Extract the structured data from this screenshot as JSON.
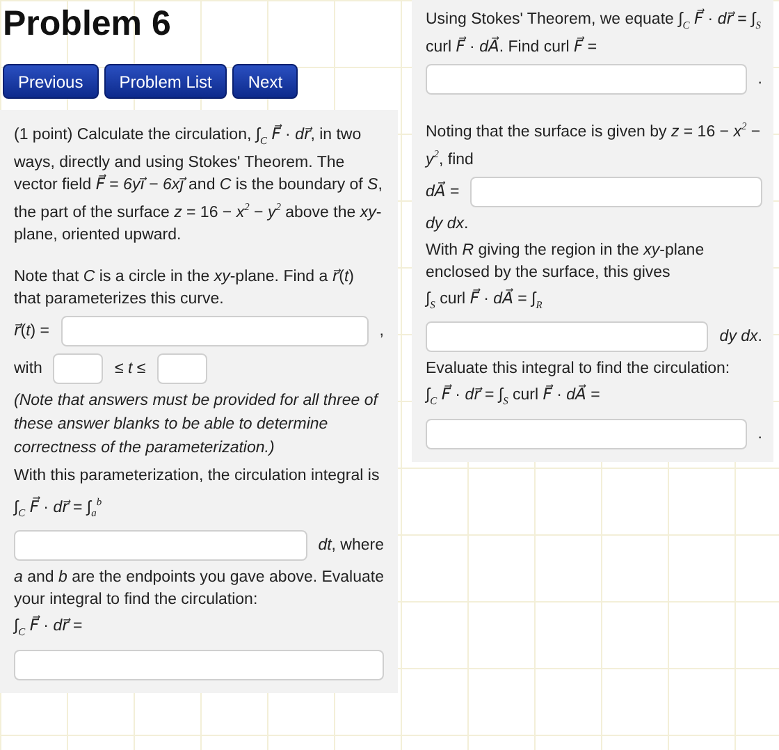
{
  "title": "Problem 6",
  "nav_buttons": [
    "Previous",
    "Problem List",
    "Next"
  ],
  "left_panel": [
    {
      "kind": "text",
      "text": "(1 point) Calculate the circulation, ∫$_{C}$ *F⃗* · *dr⃗*, in two ways, directly and using Stokes' Theorem. The vector field *F⃗* = *6yi⃗* − *6xj⃗* and *C* is the boundary of *S*, the part of the surface *z* = 16 − *x*$^{2}$ − *y*$^{2}$ above the *xy*-plane, oriented upward."
    },
    {
      "kind": "gap"
    },
    {
      "kind": "text",
      "text": "Note that *C* is a circle in the *xy*-plane. Find a *r⃗*(*t*) that parameterizes this curve."
    },
    {
      "kind": "row",
      "parts": [
        {
          "kind": "label",
          "text": "*r⃗*(*t*) ="
        },
        {
          "kind": "field"
        },
        {
          "kind": "label",
          "text": ","
        }
      ]
    },
    {
      "kind": "row",
      "parts": [
        {
          "kind": "label",
          "text": "with"
        },
        {
          "kind": "short_field"
        },
        {
          "kind": "label",
          "text": "≤ *t* ≤"
        },
        {
          "kind": "short_field"
        }
      ]
    },
    {
      "kind": "note",
      "text": "(Note that answers must be provided for all three of these answer blanks to be able to determine correctness of the parameterization.)"
    },
    {
      "kind": "text",
      "text": "With this parameterization, the circulation integral is"
    },
    {
      "kind": "text",
      "text": "∫$_{C}$ *F⃗* · *dr⃗* = ∫$_{a}$$^{b}$"
    },
    {
      "kind": "row",
      "parts": [
        {
          "kind": "field"
        },
        {
          "kind": "label",
          "text": "*dt*, where"
        }
      ]
    },
    {
      "kind": "text",
      "text": "*a* and *b* are the endpoints you gave above. Evaluate your integral to find the circulation:"
    },
    {
      "kind": "text",
      "text": "∫$_{C}$ *F⃗* · *dr⃗* ="
    },
    {
      "kind": "row",
      "parts": [
        {
          "kind": "field"
        }
      ]
    }
  ],
  "right_panel": [
    {
      "kind": "text",
      "text": "Using Stokes' Theorem, we equate ∫$_{C}$ *F⃗* · *dr⃗* = ∫$_{S}$ curl *F⃗* · *dA⃗*. Find curl *F⃗* ="
    },
    {
      "kind": "row",
      "parts": [
        {
          "kind": "field"
        },
        {
          "kind": "label",
          "text": "."
        }
      ]
    },
    {
      "kind": "gap"
    },
    {
      "kind": "text",
      "text": "Noting that the surface is given by *z* = 16 − *x*$^{2}$ − *y*$^{2}$, find"
    },
    {
      "kind": "row",
      "parts": [
        {
          "kind": "label",
          "text": "*dA⃗* ="
        },
        {
          "kind": "field"
        }
      ]
    },
    {
      "kind": "text",
      "text": "*dy dx*."
    },
    {
      "kind": "text",
      "text": "With *R* giving the region in the *xy*-plane enclosed by the surface, this gives"
    },
    {
      "kind": "text",
      "text": "∫$_{S}$ curl *F⃗* · *dA⃗* = ∫$_{R}$"
    },
    {
      "kind": "row",
      "parts": [
        {
          "kind": "field"
        },
        {
          "kind": "label",
          "text": "*dy dx*."
        }
      ]
    },
    {
      "kind": "text",
      "text": "Evaluate this integral to find the circulation:"
    },
    {
      "kind": "text",
      "text": "∫$_{C}$ *F⃗* · *dr⃗* = ∫$_{S}$ curl *F⃗* · *dA⃗* ="
    },
    {
      "kind": "row",
      "parts": [
        {
          "kind": "field"
        },
        {
          "kind": "label",
          "text": "."
        }
      ]
    }
  ]
}
